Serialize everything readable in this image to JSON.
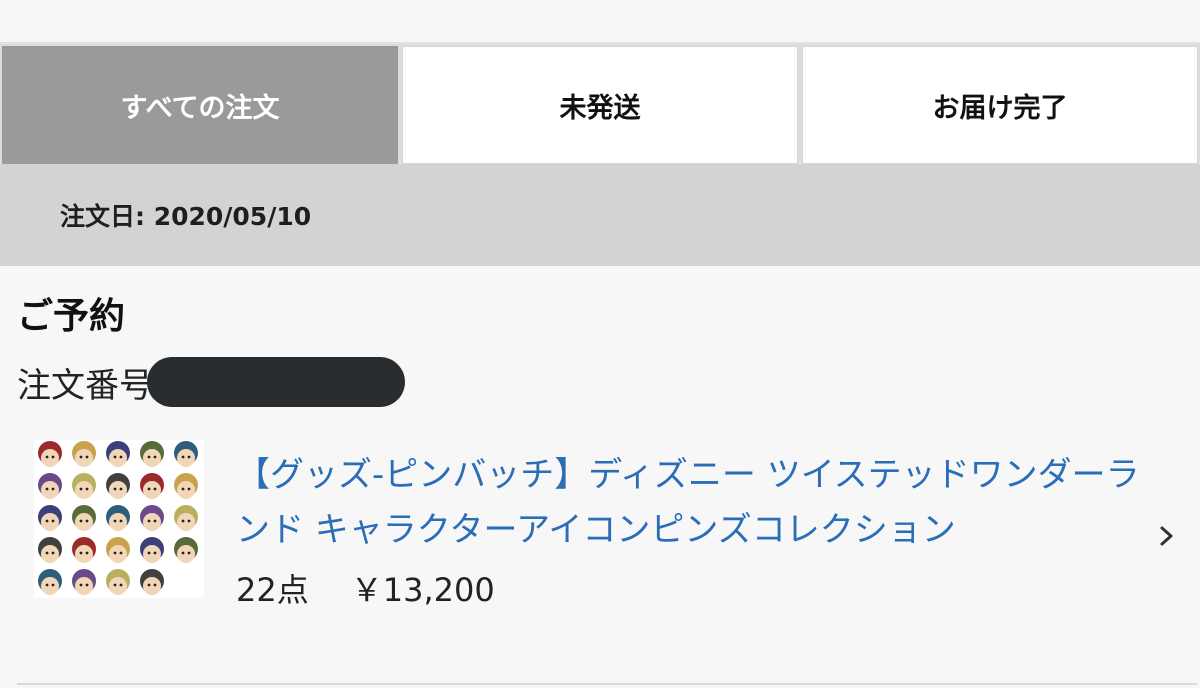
{
  "tabs": [
    {
      "label": "すべての注文",
      "active": true
    },
    {
      "label": "未発送",
      "active": false
    },
    {
      "label": "お届け完了",
      "active": false
    }
  ],
  "order": {
    "date_label": "注文日: 2020/05/10",
    "status": "ご予約",
    "number_label": "注文番号",
    "product": {
      "title": "【グッズ-ピンバッチ】ディズニー ツイステッドワンダーランド キャラクターアイコンピンズコレクション",
      "quantity": "22点",
      "price": "￥13,200",
      "thumbnail": "pin-badge-collection-image",
      "chevron": "chevron-right-icon"
    }
  },
  "colors": {
    "active_tab": "#9a9a9a",
    "link": "#2a6db8",
    "date_bar": "#d3d3d3",
    "page_bg": "#f7f7f7"
  }
}
